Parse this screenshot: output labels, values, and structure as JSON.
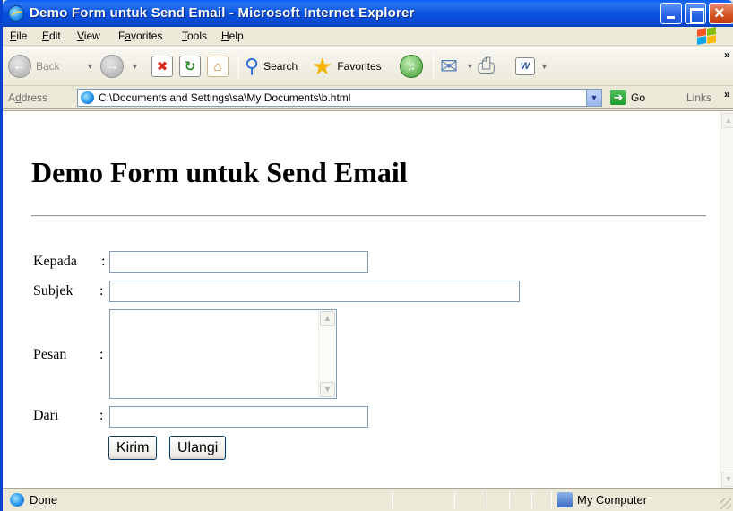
{
  "window": {
    "title": "Demo Form untuk Send Email - Microsoft Internet Explorer"
  },
  "menu": [
    {
      "label": "File",
      "hotkey": "F",
      "rest": "ile"
    },
    {
      "label": "Edit",
      "hotkey": "E",
      "rest": "dit"
    },
    {
      "label": "View",
      "hotkey": "V",
      "rest": "iew"
    },
    {
      "label": "Favorites",
      "pre": "F",
      "hotkey": "a",
      "rest": "vorites"
    },
    {
      "label": "Tools",
      "hotkey": "T",
      "rest": "ools"
    },
    {
      "label": "Help",
      "hotkey": "H",
      "rest": "elp"
    }
  ],
  "toolbar": {
    "back_label": "Back",
    "search_label": "Search",
    "favorites_label": "Favorites"
  },
  "addressbar": {
    "label": "Address",
    "label_hotkey": "d",
    "url": "C:\\Documents and Settings\\sa\\My Documents\\b.html",
    "go_label": "Go",
    "links_label": "Links"
  },
  "page": {
    "heading": "Demo Form untuk Send Email",
    "fields": {
      "kepada_label": "Kepada",
      "subjek_label": "Subjek",
      "pesan_label": "Pesan",
      "dari_label": "Dari",
      "colon": ":"
    },
    "buttons": {
      "submit": "Kirim",
      "reset": "Ulangi"
    }
  },
  "statusbar": {
    "status": "Done",
    "zone": "My Computer"
  },
  "colors": {
    "titlebar": "#0851e0",
    "accent_border": "#7f9db9"
  }
}
